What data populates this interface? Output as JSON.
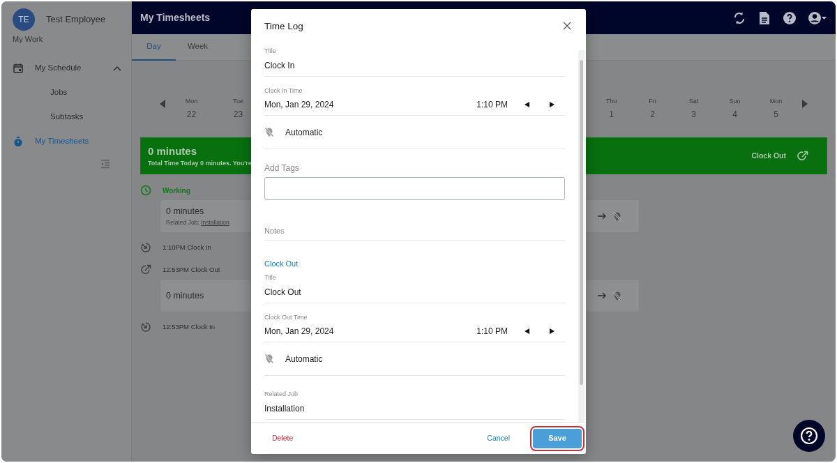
{
  "sidebar": {
    "avatar": "TE",
    "user_name": "Test Employee",
    "section": "My Work",
    "items": [
      {
        "label": "My Schedule",
        "selected": false,
        "expanded": true,
        "children": [
          {
            "label": "Jobs",
            "selected": false
          },
          {
            "label": "Subtasks",
            "selected": false
          }
        ]
      },
      {
        "label": "My Timesheets",
        "selected": true
      }
    ]
  },
  "header": {
    "title": "My Timesheets"
  },
  "tabs": [
    {
      "label": "Day",
      "selected": true
    },
    {
      "label": "Week",
      "selected": false
    }
  ],
  "week_strip": {
    "days_start": [
      {
        "weekday": "Mon",
        "day": "22"
      },
      {
        "weekday": "Tue",
        "day": "23"
      }
    ],
    "days_end": [
      {
        "weekday": "Thu",
        "day": "1"
      },
      {
        "weekday": "Fri",
        "day": "2"
      },
      {
        "weekday": "Sat",
        "day": "3"
      },
      {
        "weekday": "Sun",
        "day": "4"
      },
      {
        "weekday": "Mon",
        "day": "5"
      }
    ]
  },
  "banner": {
    "title": "0 minutes",
    "subtitle": "Total Time Today 0 minutes. You're",
    "action": "Clock Out"
  },
  "timeline": [
    {
      "kind": "status",
      "label": "Working"
    },
    {
      "kind": "card",
      "duration": "0 minutes",
      "job_label": "Related Job:",
      "job": "Installation"
    },
    {
      "kind": "clock_in",
      "label": "1:10PM Clock In"
    },
    {
      "kind": "clock_out",
      "label": "12:53PM Clock Out"
    },
    {
      "kind": "card",
      "duration": "0 minutes"
    },
    {
      "kind": "clock_in",
      "label": "12:53PM Clock In"
    }
  ],
  "modal": {
    "title": "Time Log",
    "fields": [
      {
        "kind": "text",
        "label": "Title",
        "value": "Clock In"
      },
      {
        "kind": "datetime",
        "label": "Clock In Time",
        "date": "Mon, Jan 29, 2024",
        "time": "1:10 PM"
      },
      {
        "kind": "location",
        "value": "Automatic"
      },
      {
        "kind": "tags",
        "label": "Add Tags"
      },
      {
        "kind": "notes",
        "label": "Notes"
      },
      {
        "kind": "heading",
        "label": "Clock Out"
      },
      {
        "kind": "text",
        "label": "Title",
        "value": "Clock Out"
      },
      {
        "kind": "datetime",
        "label": "Clock Out Time",
        "date": "Mon, Jan 29, 2024",
        "time": "1:10 PM"
      },
      {
        "kind": "location",
        "value": "Automatic"
      },
      {
        "kind": "text",
        "label": "Related Job",
        "value": "Installation"
      }
    ],
    "footer": {
      "delete": "Delete",
      "cancel": "Cancel",
      "save": "Save",
      "save_highlighted": true
    }
  }
}
